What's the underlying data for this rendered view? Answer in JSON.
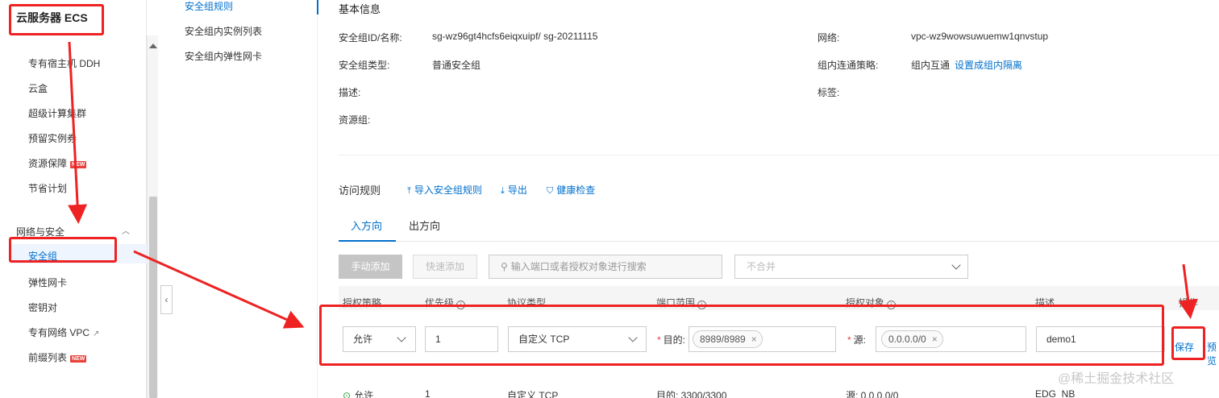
{
  "sidebar": {
    "title": "云服务器 ECS",
    "items_top": [
      "专有宿主机 DDH",
      "云盒",
      "超级计算集群",
      "预留实例券",
      "资源保障",
      "节省计划"
    ],
    "new_badge": "NEW",
    "group_label": "网络与安全",
    "items_net": [
      "安全组",
      "弹性网卡",
      "密钥对",
      "专有网络 VPC",
      "前缀列表"
    ]
  },
  "subnav": {
    "items": [
      "安全组规则",
      "安全组内实例列表",
      "安全组内弹性网卡"
    ]
  },
  "basic": {
    "title": "基本信息",
    "sg_label": "安全组ID/名称:",
    "sg_value": "sg-wz96gt4hcfs6eiqxuipf/ sg-20211115",
    "net_label": "网络:",
    "net_value": "vpc-wz9wowsuwuemw1qnvstup",
    "type_label": "安全组类型:",
    "type_value": "普通安全组",
    "policy_label": "组内连通策略:",
    "policy_value": "组内互通",
    "policy_link": "设置成组内隔离",
    "desc_label": "描述:",
    "tag_label": "标签:",
    "rg_label": "资源组:"
  },
  "rules": {
    "title": "访问规则",
    "actions": [
      "导入安全组规则",
      "导出",
      "健康检查"
    ],
    "tabs": [
      "入方向",
      "出方向"
    ],
    "add_manual": "手动添加",
    "add_quick": "快速添加",
    "search_placeholder": "输入端口或者授权对象进行搜索",
    "merge_select": "不合并",
    "columns": [
      "授权策略",
      "优先级",
      "协议类型",
      "端口范围",
      "授权对象",
      "描述",
      "操作"
    ]
  },
  "edit_row": {
    "policy": "允许",
    "priority": "1",
    "protocol": "自定义 TCP",
    "dest_label": "目的:",
    "port_tag": "8989/8989",
    "src_label": "源:",
    "src_tag": "0.0.0.0/0",
    "description": "demo1",
    "save": "保存",
    "preview": "预览"
  },
  "data_row": {
    "policy": "允许",
    "priority": "1",
    "protocol": "自定义 TCP",
    "port": "目的: 3300/3300",
    "source": "源: 0.0.0.0/0",
    "description": "EDG_NB"
  },
  "watermark": "@稀土掘金技术社区",
  "colors": {
    "accent": "#0070cc",
    "annotation": "#ee2222",
    "badge": "#e8403a"
  }
}
